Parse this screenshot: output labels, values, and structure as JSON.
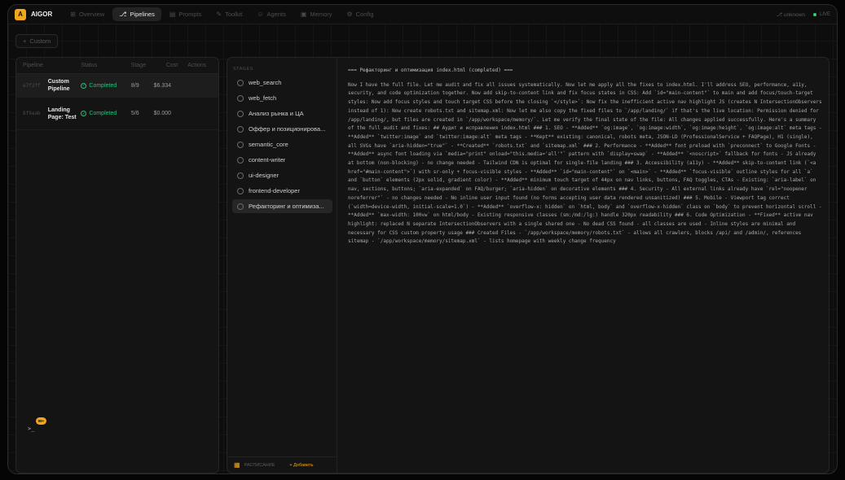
{
  "app": {
    "logo_letter": "A",
    "brand": "AIGOR"
  },
  "nav": [
    {
      "label": "Overview",
      "icon": "⊞"
    },
    {
      "label": "Pipelines",
      "icon": "⎇"
    },
    {
      "label": "Prompts",
      "icon": "▤"
    },
    {
      "label": "Toolkit",
      "icon": "✎"
    },
    {
      "label": "Agents",
      "icon": "☺"
    },
    {
      "label": "Memory",
      "icon": "▣"
    },
    {
      "label": "Config",
      "icon": "⚙"
    }
  ],
  "header": {
    "user": "unknown",
    "live": "LIVE",
    "user_icon": "⎇"
  },
  "toolbar": {
    "custom_label": "Custom",
    "custom_icon": "+"
  },
  "table": {
    "columns": [
      "Pipeline",
      "Status",
      "Stage",
      "Cost",
      "Actions"
    ],
    "rows": [
      {
        "id": "e7f2ff",
        "name": "Custom Pipeline",
        "status": "Completed",
        "stage": "8/9",
        "cost": "$6.334"
      },
      {
        "id": "8f9aab",
        "name": "Landing Page: Test",
        "status": "Completed",
        "stage": "5/6",
        "cost": "$0.000"
      }
    ]
  },
  "terminal": {
    "prompt": ">_",
    "badge": "99+"
  },
  "stages": {
    "header": "STAGES",
    "items": [
      "web_search",
      "web_fetch",
      "Анализ рынка и ЦА",
      "Оффер и позиционирова...",
      "semantic_core",
      "content-writer",
      "ui-designer",
      "frontend-developer",
      "Рефакторинг и оптимиза..."
    ],
    "footer_schedule": "РАСПИСАНИЕ",
    "footer_add": "+ Добавить"
  },
  "output": {
    "title": "=== Рефакторинг и оптимизация index.html (completed) ===",
    "body": "Now I have the full file. Let me audit and fix all issues systematically. Now let me apply all the fixes to index.html. I'll address SEO, performance, a11y, security, and code optimization together. Now add skip-to-content link and fix focus states in CSS: Add `id=\"main-content\"` to main and add focus/touch-target styles: Now add focus styles and touch target CSS before the closing `</style>`: Now fix the inefficient active nav highlight JS (creates N IntersectionObservers instead of 1): Now create robots.txt and sitemap.xml: Now let me also copy the fixed files to `/app/landing/` if that's the live location: Permission denied for /app/landing/, but files are created in `/app/workspace/memory/`. Let me verify the final state of the file: All changes applied successfully. Here's a summary of the full audit and fixes: ## Аудит и исправления index.html ### 1. SEO - **Added** `og:image`, `og:image:width`, `og:image:height`, `og:image:alt` meta tags - **Added** `twitter:image` and `twitter:image:alt` meta tags - **Kept** existing: canonical, robots meta, JSON-LD (ProfessionalService + FAQPage), H1 (single), all SVGs have `aria-hidden=\"true\"` - **Created** `robots.txt` and `sitemap.xml` ### 2. Performance - **Added** font preload with `preconnect` to Google Fonts - **Added** async font loading via `media=\"print\" onload=\"this.media='all'\"` pattern with `display=swap` - **Added** `<noscript>` fallback for fonts - JS already at bottom (non-blocking) - no change needed - Tailwind CDN is optimal for single-file landing ### 3. Accessibility (a11y) - **Added** skip-to-content link (`<a href=\"#main-content\">`) with sr-only + focus-visible styles - **Added** `id=\"main-content\"` on `<main>` - **Added** `focus-visible` outline styles for all `a` and `button` elements (2px solid, gradient color) - **Added** minimum touch target of 44px on nav links, buttons, FAQ toggles, CTAs - Existing: `aria-label` on nav, sections, buttons; `aria-expanded` on FAQ/burger; `aria-hidden` on decorative elements ### 4. Security - All external links already have `rel=\"noopener noreferrer\"` - no changes needed - No inline user input found (no forms accepting user data rendered unsanitized) ### 5. Mobile - Viewport tag correct (`width=device-width, initial-scale=1.0`) - **Added** `overflow-x: hidden` on `html, body` and `overflow-x-hidden` class on `body` to prevent horizontal scroll - **Added** `max-width: 100vw` on html/body - Existing responsive classes (sm:/md:/lg:) handle 320px readability ### 6. Code Optimization - **Fixed** active nav highlight: replaced N separate IntersectionObservers with a single shared one - No dead CSS found - all classes are used - Inline styles are minimal and necessary for CSS custom property usage ### Created Files - `/app/workspace/memory/robots.txt` - allows all crawlers, blocks /api/ and /admin/, references sitemap - `/app/workspace/memory/sitemap.xml` - lists homepage with weekly change frequency"
  }
}
